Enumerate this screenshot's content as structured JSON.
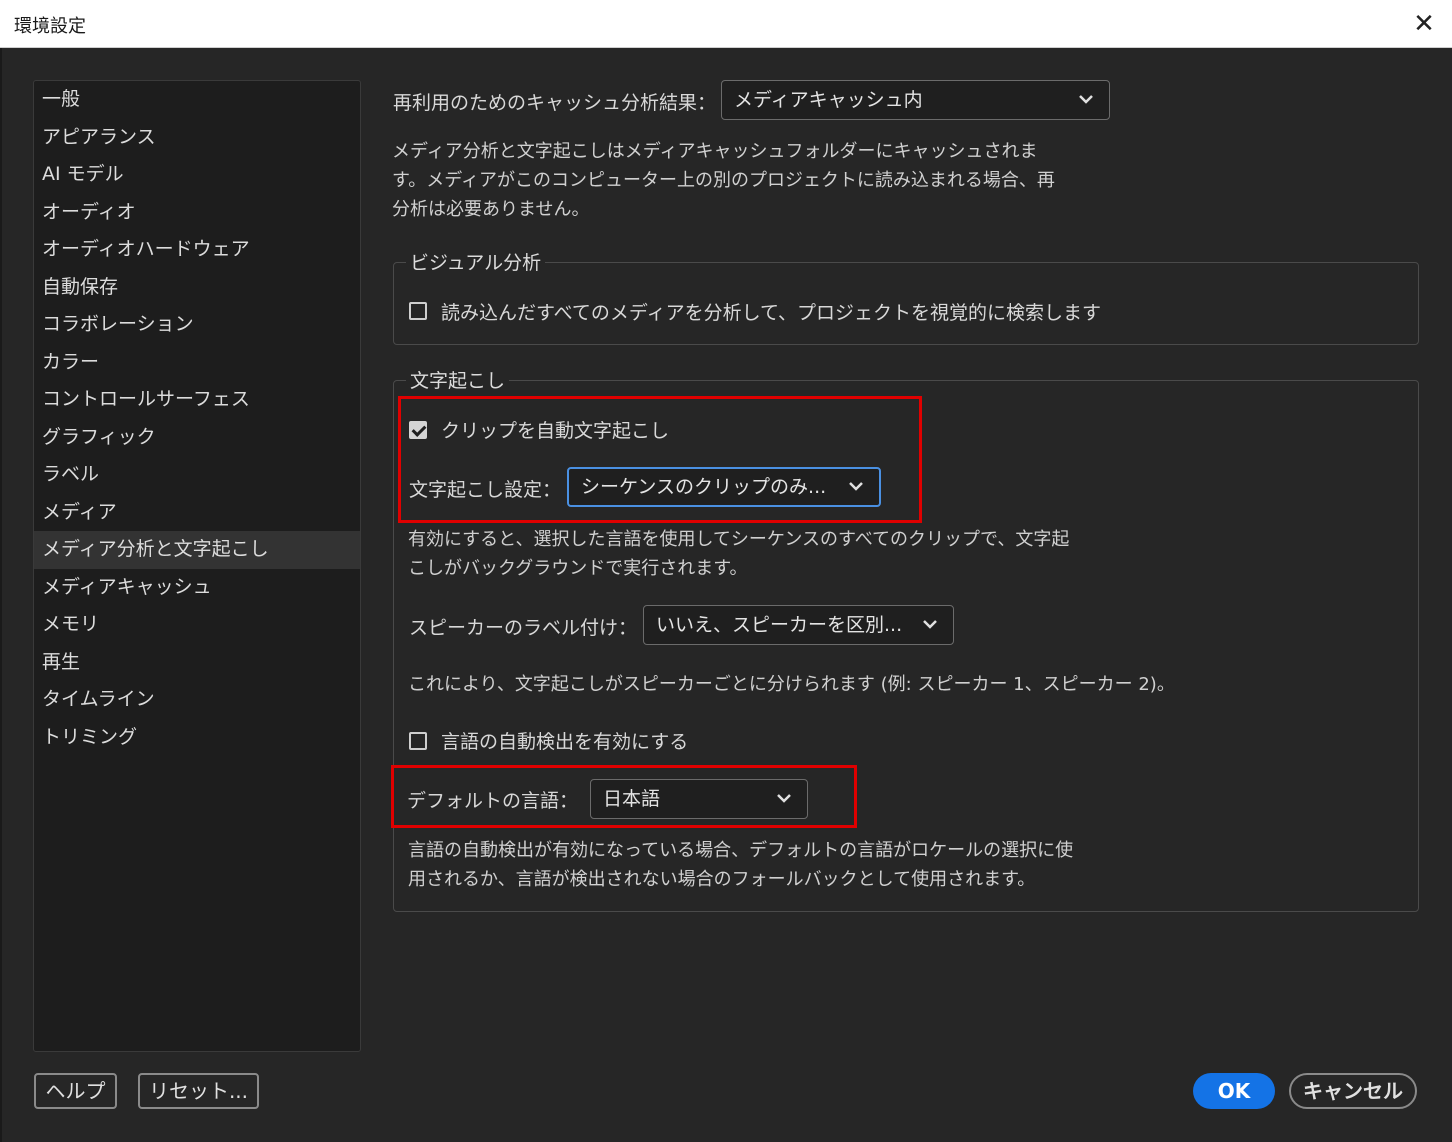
{
  "window": {
    "title": "環境設定",
    "close_glyph": "✕"
  },
  "sidebar": {
    "items": [
      {
        "label": "一般"
      },
      {
        "label": "アピアランス"
      },
      {
        "label": "AI モデル"
      },
      {
        "label": "オーディオ"
      },
      {
        "label": "オーディオハードウェア"
      },
      {
        "label": "自動保存"
      },
      {
        "label": "コラボレーション"
      },
      {
        "label": "カラー"
      },
      {
        "label": "コントロールサーフェス"
      },
      {
        "label": "グラフィック"
      },
      {
        "label": "ラベル"
      },
      {
        "label": "メディア"
      },
      {
        "label": "メディア分析と文字起こし",
        "selected": true
      },
      {
        "label": "メディアキャッシュ"
      },
      {
        "label": "メモリ"
      },
      {
        "label": "再生"
      },
      {
        "label": "タイムライン"
      },
      {
        "label": "トリミング"
      }
    ]
  },
  "main": {
    "cache_label": "再利用のためのキャッシュ分析結果：",
    "cache_value": "メディアキャッシュ内",
    "cache_desc": [
      "メディア分析と文字起こしはメディアキャッシュフォルダーにキャッシュされま",
      "す。メディアがこのコンピューター上の別のプロジェクトに読み込まれる場合、再",
      "分析は必要ありません。"
    ],
    "visual": {
      "legend": "ビジュアル分析",
      "checkbox_label": "読み込んだすべてのメディアを分析して、プロジェクトを視覚的に検索します",
      "checked": false
    },
    "transcription": {
      "legend": "文字起こし",
      "auto_label": "クリップを自動文字起こし",
      "auto_checked": true,
      "settings_label": "文字起こし設定：",
      "settings_value": "シーケンスのクリップのみ...",
      "settings_desc": [
        "有効にすると、選択した言語を使用してシーケンスのすべてのクリップで、文字起",
        "こしがバックグラウンドで実行されます。"
      ],
      "speaker_label": "スピーカーのラベル付け：",
      "speaker_value": "いいえ、スピーカーを区別...",
      "speaker_desc": "これにより、文字起こしがスピーカーごとに分けられます (例: スピーカー 1、スピーカー 2)。",
      "autodetect_label": "言語の自動検出を有効にする",
      "autodetect_checked": false,
      "default_lang_label": "デフォルトの言語：",
      "default_lang_value": "日本語",
      "default_lang_desc": [
        "言語の自動検出が有効になっている場合、デフォルトの言語がロケールの選択に使",
        "用されるか、言語が検出されない場合のフォールバックとして使用されます。"
      ]
    }
  },
  "footer": {
    "help": "ヘルプ",
    "reset": "リセット...",
    "ok": "OK",
    "cancel": "キャンセル"
  },
  "colors": {
    "accent": "#1473e6",
    "highlight": "#e00000",
    "background": "#262626"
  }
}
